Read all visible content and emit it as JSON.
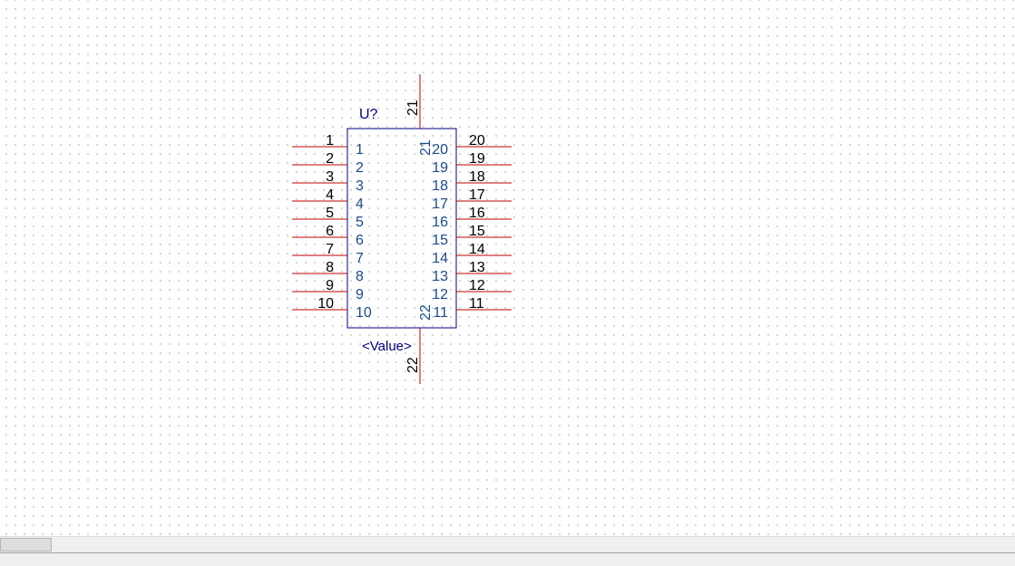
{
  "symbol": {
    "reference": "U?",
    "value": "<Value>",
    "power_pins": {
      "top": "21",
      "bottom": "22"
    },
    "left_pins": [
      {
        "number": "1",
        "name": "1"
      },
      {
        "number": "2",
        "name": "2"
      },
      {
        "number": "3",
        "name": "3"
      },
      {
        "number": "4",
        "name": "4"
      },
      {
        "number": "5",
        "name": "5"
      },
      {
        "number": "6",
        "name": "6"
      },
      {
        "number": "7",
        "name": "7"
      },
      {
        "number": "8",
        "name": "8"
      },
      {
        "number": "9",
        "name": "9"
      },
      {
        "number": "10",
        "name": "10"
      }
    ],
    "right_pins": [
      {
        "number": "20",
        "name": "20"
      },
      {
        "number": "19",
        "name": "19"
      },
      {
        "number": "18",
        "name": "18"
      },
      {
        "number": "17",
        "name": "17"
      },
      {
        "number": "16",
        "name": "16"
      },
      {
        "number": "15",
        "name": "15"
      },
      {
        "number": "14",
        "name": "14"
      },
      {
        "number": "13",
        "name": "13"
      },
      {
        "number": "12",
        "name": "12"
      },
      {
        "number": "11",
        "name": "11"
      }
    ]
  },
  "colors": {
    "pin": "#c00000",
    "body_outline": "#000080",
    "label": "#000080",
    "pin_name": "#1c4b8c",
    "grid_dot": "#c8c8c8"
  }
}
